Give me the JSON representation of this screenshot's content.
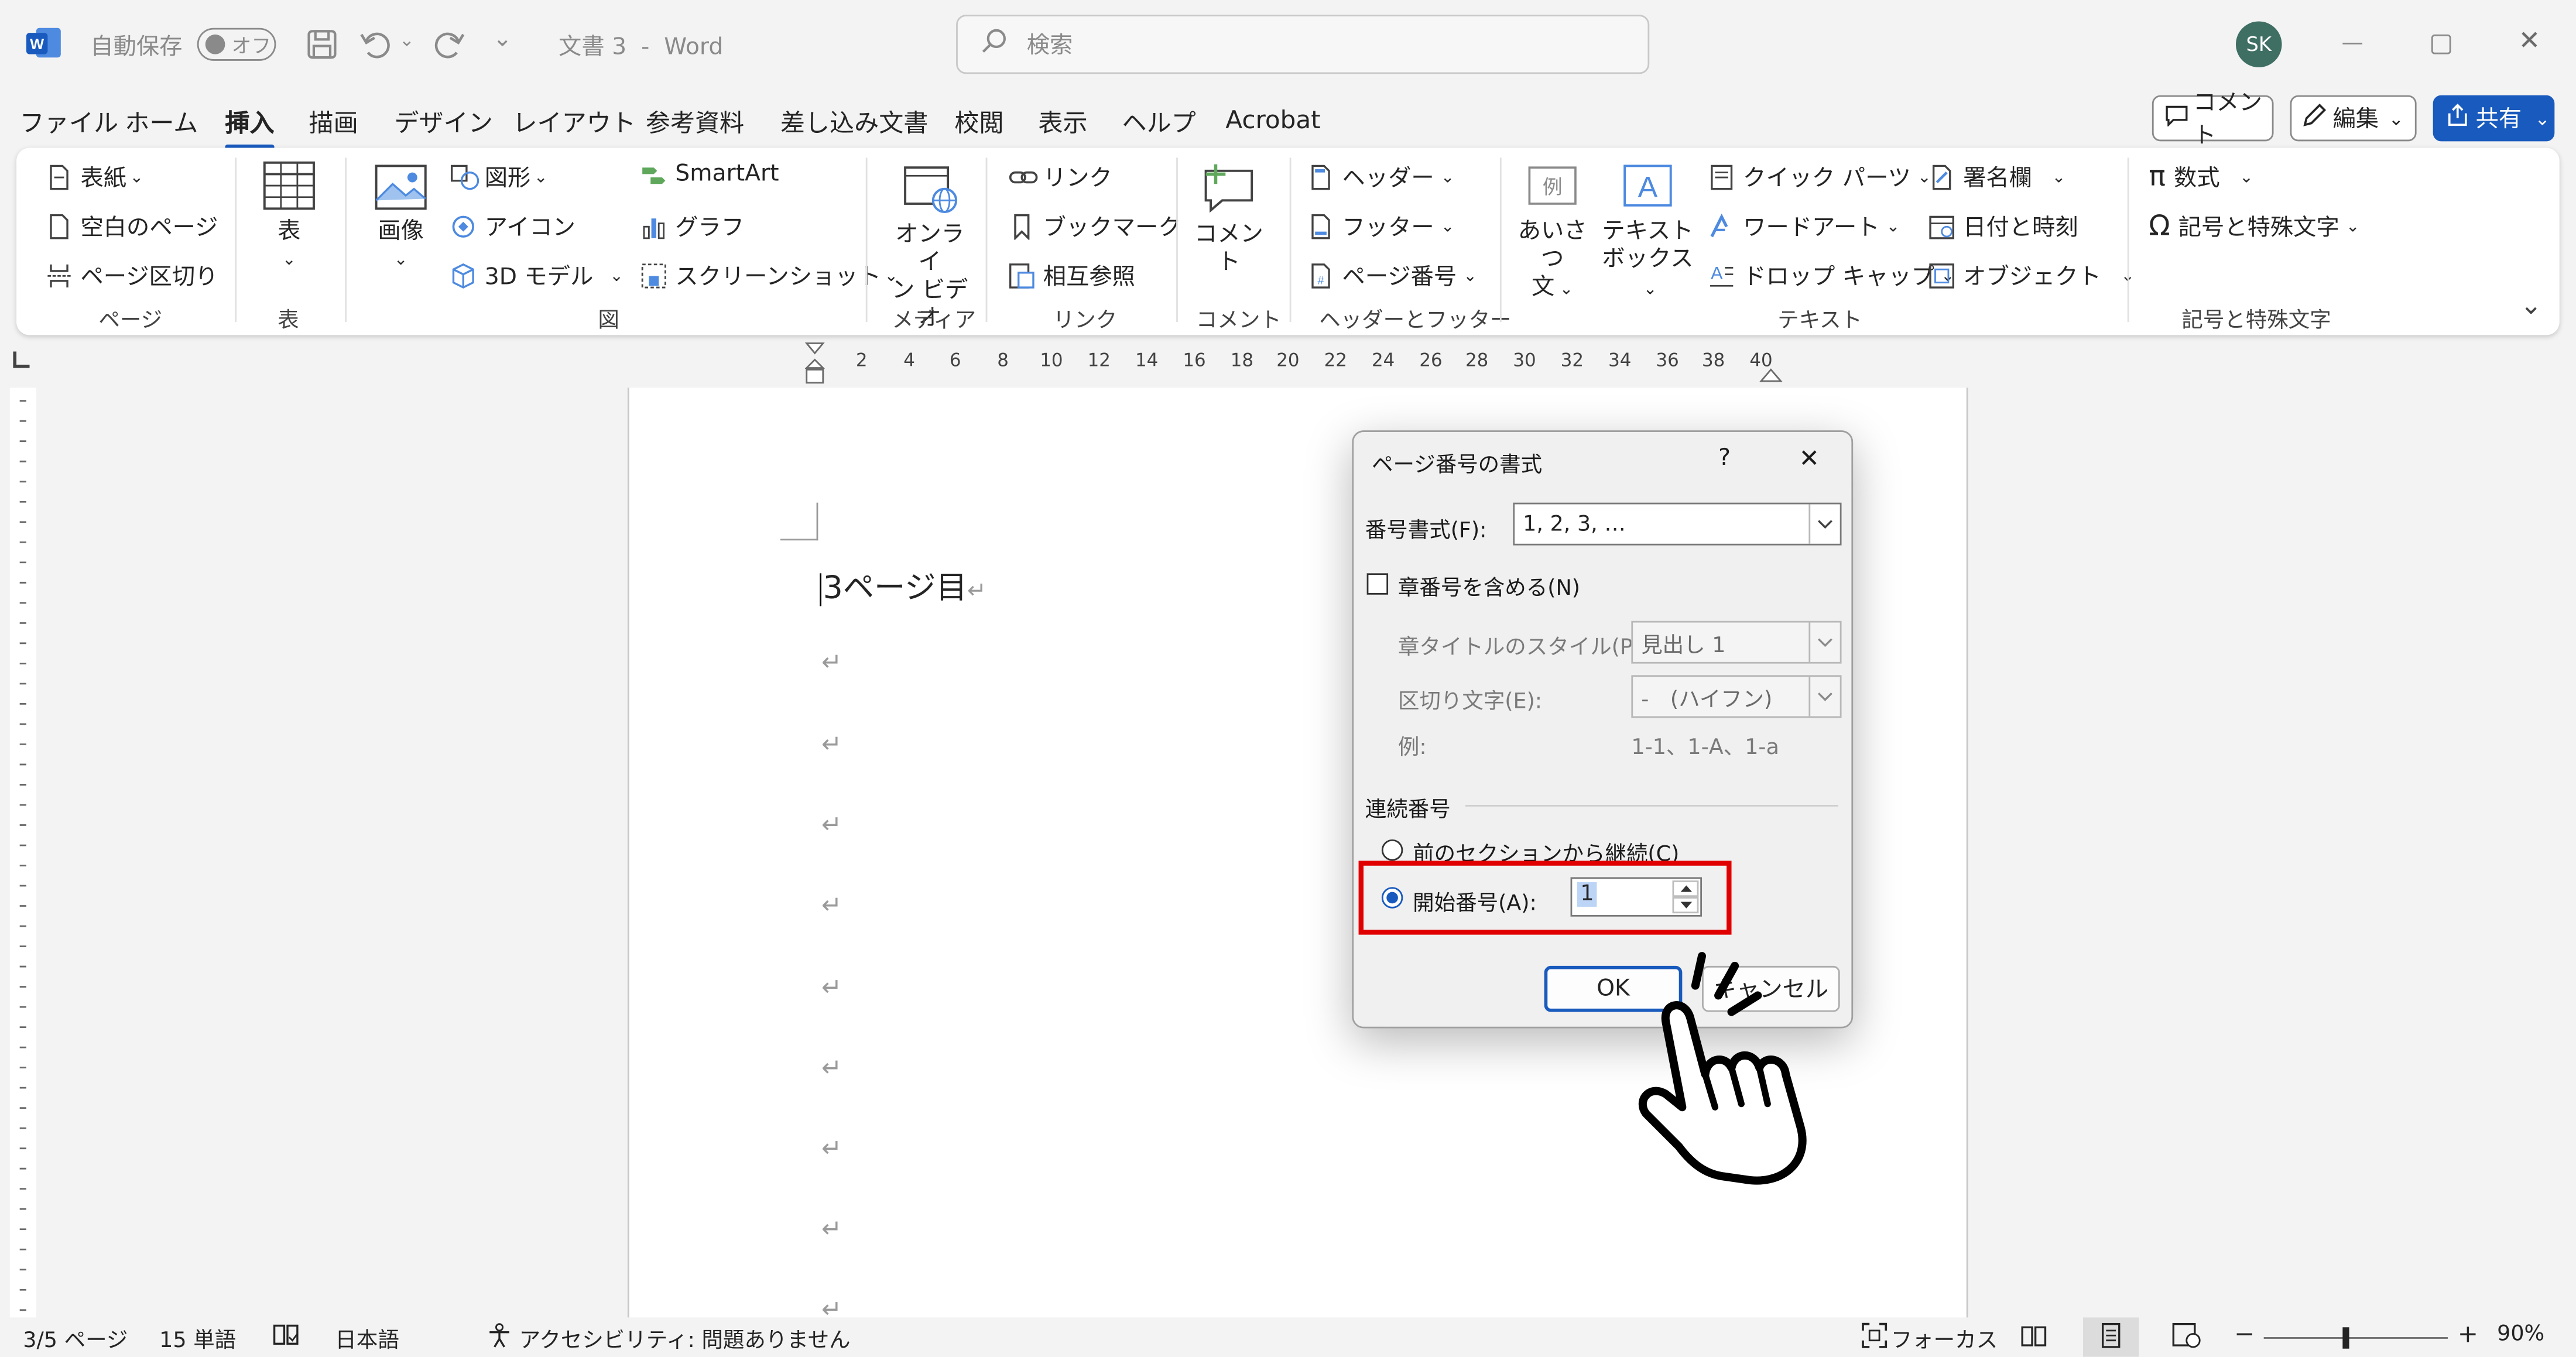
{
  "titlebar": {
    "autosave_label": "自動保存",
    "autosave_state": "オフ",
    "doc_title": "文書 3",
    "separator": "-",
    "app_name": "Word",
    "search_placeholder": "検索",
    "avatar_initials": "SK"
  },
  "menu": {
    "items": [
      "ファイル",
      "ホーム",
      "挿入",
      "描画",
      "デザイン",
      "レイアウト",
      "参考資料",
      "差し込み文書",
      "校閲",
      "表示",
      "ヘルプ",
      "Acrobat"
    ],
    "active": "挿入",
    "comments_label": "コメント",
    "editing_label": "編集",
    "share_label": "共有"
  },
  "ribbon": {
    "pages": {
      "cover": "表紙",
      "blank": "空白のページ",
      "break": "ページ区切り",
      "label": "ページ"
    },
    "table": {
      "button": "表",
      "label": "表"
    },
    "illustrations": {
      "picture": "画像",
      "shapes": "図形",
      "icons": "アイコン",
      "models3d": "3D モデル",
      "smartart": "SmartArt",
      "chart": "グラフ",
      "screenshot": "スクリーンショット",
      "label": "図"
    },
    "media": {
      "online_video_line1": "オンライ",
      "online_video_line2": "ン ビデオ",
      "label": "メディア"
    },
    "links": {
      "link": "リンク",
      "bookmark": "ブックマーク",
      "crossref": "相互参照",
      "label": "リンク"
    },
    "comments": {
      "comment": "コメント",
      "label": "コメント"
    },
    "header_footer": {
      "header": "ヘッダー",
      "footer": "フッター",
      "page_number": "ページ番号",
      "label": "ヘッダーとフッター"
    },
    "text": {
      "greeting_line1": "あいさつ",
      "greeting_line2": "文",
      "textbox_line1": "テキスト",
      "textbox_line2": "ボックス",
      "quickparts": "クイック パーツ",
      "wordart": "ワードアート",
      "dropcap": "ドロップ キャップ",
      "signature": "署名欄",
      "datetime": "日付と時刻",
      "object": "オブジェクト",
      "label": "テキスト"
    },
    "symbols": {
      "equation": "数式",
      "symbol": "記号と特殊文字",
      "label": "記号と特殊文字"
    },
    "collapse_label": "⌄"
  },
  "ruler": {
    "ticks": [
      "2",
      "4",
      "6",
      "8",
      "10",
      "12",
      "14",
      "16",
      "18",
      "20",
      "22",
      "24",
      "26",
      "28",
      "30",
      "32",
      "34",
      "36",
      "38",
      "40"
    ]
  },
  "document": {
    "first_line": "3ページ目",
    "para_mark": "↵"
  },
  "dialog": {
    "title": "ページ番号の書式",
    "help": "?",
    "close": "✕",
    "number_format_label": "番号書式(F):",
    "number_format_value": "1, 2, 3, …",
    "include_chapter_label": "章番号を含める(N)",
    "chapter_style_label": "章タイトルのスタイル(P):",
    "chapter_style_value": "見出し 1",
    "separator_label": "区切り文字(E):",
    "separator_value": "-　(ハイフン)",
    "example_label": "例:",
    "example_value": "1-1、1-A、1-a",
    "section_label": "連続番号",
    "continue_label": "前のセクションから継続(C)",
    "start_at_label": "開始番号(A):",
    "start_at_value": "1",
    "ok_label": "OK",
    "cancel_label": "キャンセル",
    "highlight_color": "#e00000"
  },
  "statusbar": {
    "page": "3/5 ページ",
    "words": "15 単語",
    "language": "日本語",
    "accessibility": "アクセシビリティ: 問題ありません",
    "focus": "フォーカス",
    "zoom_minus": "−",
    "zoom_plus": "+",
    "zoom": "90%"
  },
  "colors": {
    "accent": "#185abd",
    "avatar": "#3f6e63",
    "word_blue": "#185abd"
  }
}
